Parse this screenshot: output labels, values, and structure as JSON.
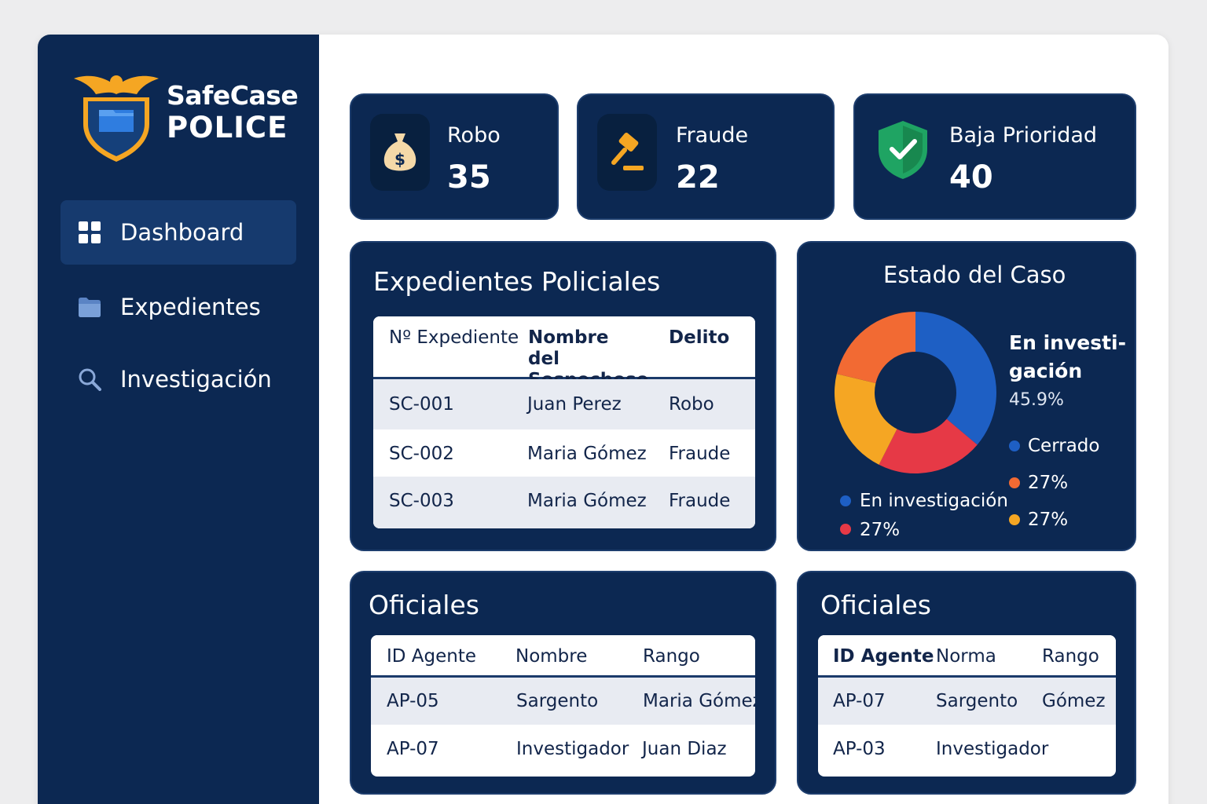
{
  "brand": {
    "name": "SafeCase",
    "sub": "POLICE"
  },
  "sidebar": {
    "items": [
      {
        "label": "Dashboard",
        "icon": "grid-icon",
        "active": true
      },
      {
        "label": "Expedientes",
        "icon": "folder-icon",
        "active": false
      },
      {
        "label": "Investigación",
        "icon": "search-icon",
        "active": false
      }
    ]
  },
  "stats": [
    {
      "label": "Robo",
      "value": "35",
      "icon": "money-bag-icon"
    },
    {
      "label": "Fraude",
      "value": "22",
      "icon": "gavel-icon"
    },
    {
      "label": "Baja Prioridad",
      "value": "40",
      "icon": "shield-check-icon"
    }
  ],
  "expedientes": {
    "title": "Expedientes Policiales",
    "headers": [
      "Nº Expediente",
      "Nombre del Sospechoso",
      "Delito"
    ],
    "rows": [
      [
        "SC-001",
        "Juan Perez",
        "Robo"
      ],
      [
        "SC-002",
        "Maria Gómez",
        "Fraude"
      ],
      [
        "SC-003",
        "Maria Gómez",
        "Fraude"
      ]
    ]
  },
  "estado": {
    "title": "Estado del Caso",
    "highlight_label": "En investi-\ngación",
    "highlight_value": "45.9%",
    "legend": [
      {
        "label": "Cerrado",
        "color": "#1e5fc4"
      },
      {
        "label": "27%",
        "color": "#f26a33"
      },
      {
        "label": "27%",
        "color": "#f5a623"
      },
      {
        "label": "En investigación",
        "color": "#1e5fc4"
      },
      {
        "label": "27%",
        "color": "#e63946"
      }
    ]
  },
  "chart_data": {
    "type": "pie",
    "title": "Estado del Caso",
    "slices": [
      {
        "label": "En investigación",
        "value": 45.9,
        "color": "#1e5fc4"
      },
      {
        "label": "",
        "value": 27,
        "color": "#e63946"
      },
      {
        "label": "",
        "value": 27,
        "color": "#f5a623"
      },
      {
        "label": "",
        "value": 27,
        "color": "#f26a33"
      }
    ]
  },
  "oficiales_left": {
    "title": "Oficiales",
    "headers": [
      "ID Agente",
      "Nombre",
      "Rango"
    ],
    "rows": [
      [
        "AP-05",
        "Sargento",
        "Maria Gómez"
      ],
      [
        "AP-07",
        "Investigador",
        "Juan Diaz"
      ]
    ]
  },
  "oficiales_right": {
    "title": "Oficiales",
    "headers": [
      "ID Agente",
      "Norma",
      "Rango"
    ],
    "rows": [
      [
        "AP-07",
        "Sargento",
        "Gómez"
      ],
      [
        "AP-03",
        "Investigador",
        ""
      ]
    ]
  }
}
